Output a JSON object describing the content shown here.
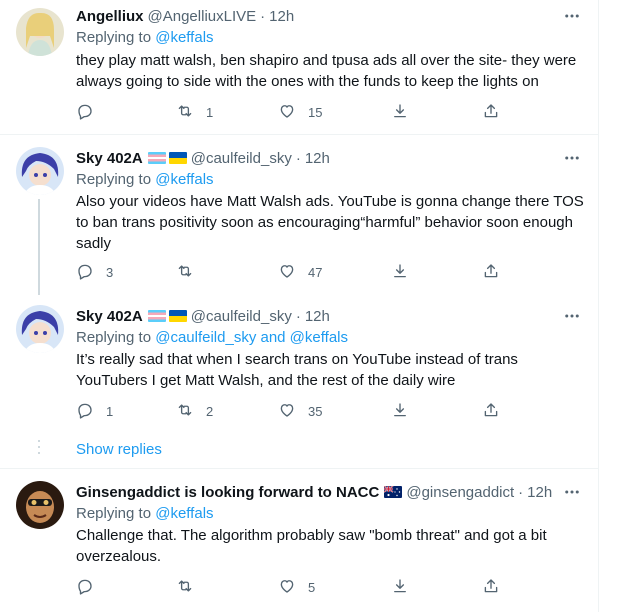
{
  "tweets": [
    {
      "name": "Angelliux",
      "handle": "@AngelliuxLIVE",
      "time": "12h",
      "replying_label": "Replying to",
      "replying_to": "@keffals",
      "text": "they play matt walsh, ben shapiro and tpusa ads all over the site- they were always going to side with the ones with the funds to keep the lights on",
      "replies": "",
      "retweets": "1",
      "likes": "15"
    },
    {
      "name": "Sky 402A",
      "handle": "@caulfeild_sky",
      "time": "12h",
      "replying_label": "Replying to",
      "replying_to": "@keffals",
      "text": "Also your videos have Matt Walsh ads. YouTube is gonna change there TOS to ban trans positivity soon as encouraging“harmful” behavior soon enough sadly",
      "replies": "3",
      "retweets": "",
      "likes": "47"
    },
    {
      "name": "Sky 402A",
      "handle": "@caulfeild_sky",
      "time": "12h",
      "replying_label": "Replying to",
      "replying_to": "@caulfeild_sky and @keffals",
      "text": "It’s really sad that when I search trans on YouTube instead of trans YouTubers I get Matt Walsh, and the rest of the daily wire",
      "replies": "1",
      "retweets": "2",
      "likes": "35"
    },
    {
      "name": "Ginsengaddict is looking forward to NACC",
      "handle": "@ginsengaddict",
      "time": "12h",
      "replying_label": "Replying to",
      "replying_to": "@keffals",
      "text": "Challenge that. The algorithm probably saw \"bomb threat\" and got a bit overzealous.",
      "replies": "",
      "retweets": "",
      "likes": "5"
    }
  ],
  "show_replies": "Show replies",
  "dot": "·",
  "colors": {
    "link": "#1d9bf0",
    "secondary": "#536471",
    "text": "#0f1419",
    "border": "#eff3f4"
  },
  "icons": [
    "reply-icon",
    "retweet-icon",
    "like-icon",
    "share-icon",
    "upload-icon",
    "more-icon",
    "trans-flag-icon",
    "ukraine-flag-icon",
    "australia-flag-icon"
  ]
}
